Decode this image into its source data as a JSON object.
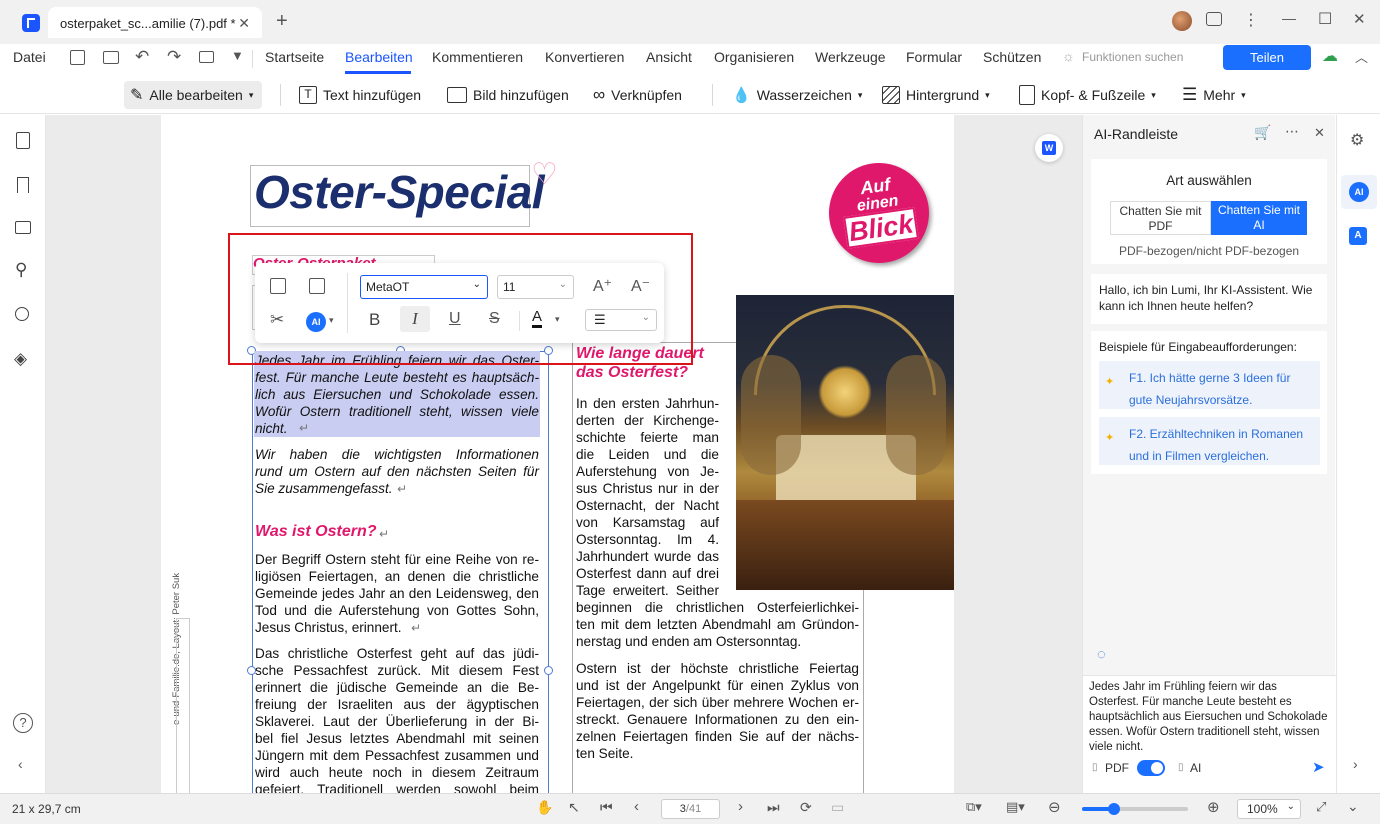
{
  "tab": {
    "title": "osterpaket_sc...amilie (7).pdf *",
    "close": "✕",
    "new": "+"
  },
  "window": {
    "minimize": "—",
    "maximize": "☐",
    "close": "✕"
  },
  "menu": {
    "file": "Datei",
    "items": [
      "Startseite",
      "Bearbeiten",
      "Kommentieren",
      "Konvertieren",
      "Ansicht",
      "Organisieren",
      "Werkzeuge",
      "Formular",
      "Schützen"
    ],
    "search": "Funktionen suchen",
    "share": "Teilen"
  },
  "toolbar": {
    "edit_all": "Alle bearbeiten",
    "add_text": "Text hinzufügen",
    "add_image": "Bild hinzufügen",
    "link": "Verknüpfen",
    "watermark": "Wasserzeichen",
    "background": "Hintergrund",
    "header_footer": "Kopf- & Fußzeile",
    "more": "Mehr"
  },
  "float_toolbar": {
    "font": "MetaOT",
    "size": "11"
  },
  "doc": {
    "title": "Oster-Special",
    "badge": [
      "Auf",
      "einen",
      "Blick"
    ],
    "left_intro": "Jedes Jahr im Frühling feiern wir das Osterfest. Für manche Leute besteht es hauptsächlich aus Eiersuchen und Schokolade essen. Wofür Ostern traditionell steht, wissen viele nicht.",
    "left_intro_lines": [
      "Jedes Jahr im Frühling feiern wir das Oster-",
      "fest. Für manche Leute besteht es hauptsäch-",
      "lich aus Eiersuchen und Schokolade essen.",
      "Wofür Ostern traditionell steht, wissen viele",
      "nicht."
    ],
    "left_para2_lines": [
      "Wir haben die wichtigsten Informationen",
      "rund um Ostern auf den nächsten Seiten für",
      "Sie zusammengefasst."
    ],
    "h_was": "Was ist Ostern?",
    "left_para3_lines": [
      "Der Begriff Ostern steht für eine Reihe von re-",
      "ligiösen Feiertagen, an denen die christliche",
      "Gemeinde jedes Jahr an den Leidensweg, den",
      "Tod und die Auferstehung von Gottes Sohn,",
      "Jesus Christus, erinnert."
    ],
    "left_para4_lines": [
      "Das christliche Osterfest geht auf das jüdi-",
      "sche Pessachfest zurück. Mit diesem Fest",
      "erinnert die jüdische Gemeinde an die Be-",
      "freiung der Israeliten aus der ägyptischen",
      "Sklaverei. Laut der Überlieferung in der Bi-",
      "bel fiel Jesus letztes Abendmahl mit seinen",
      "Jüngern mit dem Pessachfest zusammen und",
      "wird auch heute noch in diesem Zeitraum",
      "gefeiert. Traditionell werden sowohl beim"
    ],
    "h_wie": [
      "Wie lange dauert",
      "das Osterfest?"
    ],
    "mid_lines": [
      "In den ersten Jahrhun-",
      "derten der Kirchenge-",
      "schichte feierte man",
      "die Leiden und die",
      "Auferstehung von Je-",
      "sus Christus nur in der",
      "Osternacht, der Nacht",
      "von Karsamstag auf",
      "Ostersonntag. Im 4.",
      "Jahrhundert wurde das",
      "Osterfest dann auf drei",
      "Tage erweitert. Seither"
    ],
    "mid_wide_lines": [
      "beginnen die christlichen Osterfeierlichkei-",
      "ten mit dem letzten Abendmahl am Gründon-",
      "nerstag und enden am Ostersonntag."
    ],
    "mid_para2_lines": [
      "Ostern ist der höchste christliche Feiertag",
      "und ist der Angelpunkt für einen Zyklus von",
      "Feiertagen, der sich über mehrere Wochen er-",
      "streckt. Genauere Informationen zu den ein-",
      "zelnen Feiertagen finden Sie auf der nächs-",
      "ten Seite."
    ],
    "side_credit": "e-und-Familie.de, Layout: Peter Suk"
  },
  "ai": {
    "title": "AI-Randleiste",
    "choose": "Art auswählen",
    "opt_pdf": "Chatten Sie mit PDF",
    "opt_ai": "Chatten Sie mit AI",
    "sub": "PDF-bezogen/nicht PDF-bezogen",
    "greeting": "Hallo, ich bin Lumi, Ihr KI-Assistent. Wie kann ich Ihnen heute helfen?",
    "examples_title": "Beispiele für Eingabeaufforderungen:",
    "ex1": "F1. Ich hätte gerne 3 Ideen für gute Neujahrsvorsätze.",
    "ex2": "F2. Erzähltechniken in Romanen und in Filmen vergleichen.",
    "input": "Jedes Jahr im Frühling feiern wir das Osterfest. Für manche Leute besteht es hauptsächlich aus Eiersuchen und Schokolade essen. Wofür Ostern traditionell steht, wissen viele nicht.",
    "toggle_pdf": "PDF",
    "toggle_ai": "AI",
    "toggle_on": true
  },
  "status": {
    "size": "21 x 29,7 cm",
    "page": "3",
    "total": "/41",
    "zoom": "100%",
    "zoom_level": 0.3
  },
  "colors": {
    "accent": "#1a6fff",
    "pink": "#e0186c",
    "title_blue": "#1b2f6e",
    "highlight": "#c9cdf1",
    "red_box": "#d9141a"
  }
}
